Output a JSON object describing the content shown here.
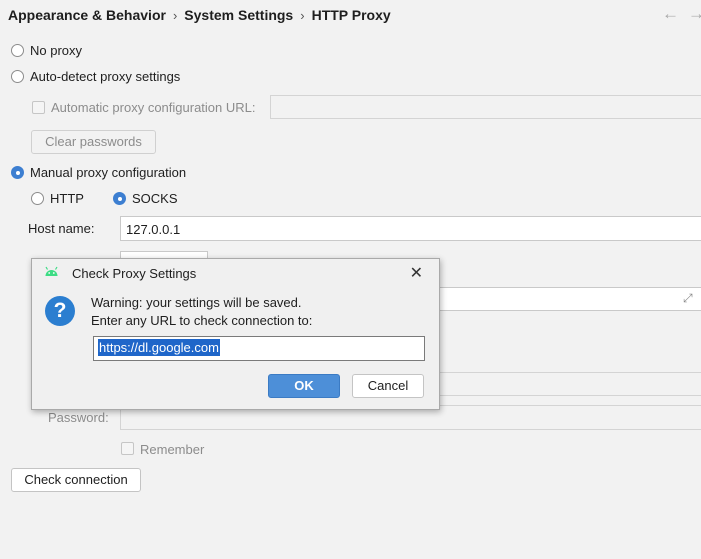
{
  "breadcrumb": {
    "items": [
      "Appearance & Behavior",
      "System Settings",
      "HTTP Proxy"
    ],
    "separator": "›"
  },
  "nav": {
    "back_glyph": "←",
    "forward_glyph": "→"
  },
  "proxy": {
    "no_proxy": "No proxy",
    "auto_detect": "Auto-detect proxy settings",
    "auto_config_url_label": "Automatic proxy configuration URL:",
    "auto_config_url_value": "",
    "clear_passwords": "Clear passwords",
    "manual": "Manual proxy configuration",
    "protocol_http": "HTTP",
    "protocol_socks": "SOCKS",
    "selected_mode": "Manual proxy configuration",
    "selected_protocol": "SOCKS",
    "host_label": "Host name:",
    "host_value": "127.0.0.1",
    "password_label": "Password:",
    "remember": "Remember",
    "check_connection": "Check connection"
  },
  "dialog": {
    "title": "Check Proxy Settings",
    "close_glyph": "✕",
    "help_glyph": "?",
    "warning": "Warning: your settings will be saved.",
    "prompt": "Enter any URL to check connection to:",
    "url_value": "https://dl.google.com",
    "ok": "OK",
    "cancel": "Cancel"
  },
  "icons": [
    "android-icon",
    "help-question-icon",
    "close-icon",
    "expand-icon",
    "back-arrow-icon",
    "forward-arrow-icon"
  ],
  "colors": {
    "accent": "#3d7fd1",
    "ok_button": "#4d8fd8",
    "android_green": "#3ddc84",
    "selection": "#1f66c9"
  }
}
